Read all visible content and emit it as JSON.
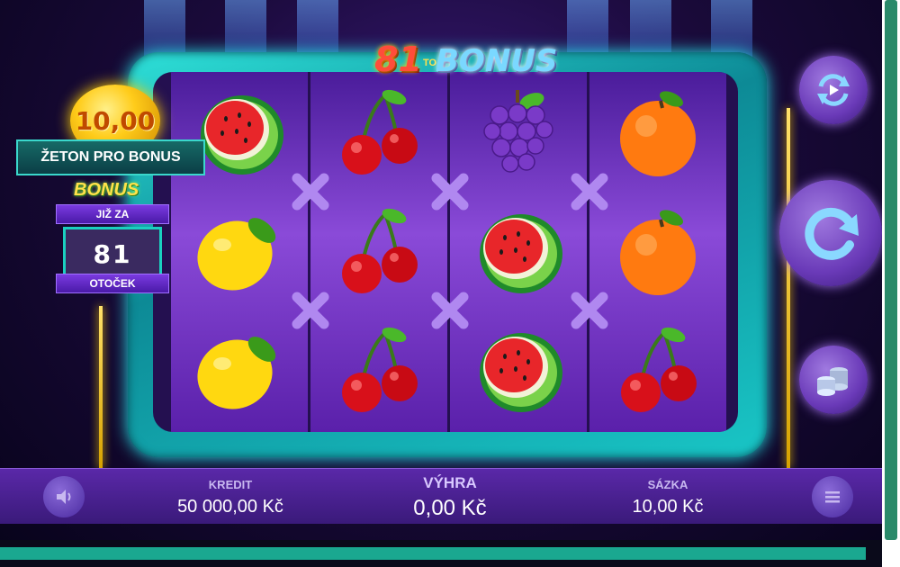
{
  "game": {
    "logo_number": "81",
    "logo_to": "TO",
    "logo_word": "BONUS"
  },
  "bonus_widget": {
    "coin_value": "10,00",
    "token_label": "ŽETON PRO BONUS",
    "bonus_title": "BONUS",
    "already_in": "JIŽ ZA",
    "spins_left": "81",
    "spins_label": "OTOČEK"
  },
  "reels": [
    [
      "watermelon",
      "lemon",
      "lemon"
    ],
    [
      "cherries",
      "cherries",
      "cherries"
    ],
    [
      "grapes",
      "watermelon",
      "watermelon"
    ],
    [
      "orange",
      "orange",
      "cherries"
    ]
  ],
  "bottom_bar": {
    "credit_label": "KREDIT",
    "credit_value": "50 000,00 Kč",
    "win_label": "VÝHRA",
    "win_value": "0,00 Kč",
    "bet_label": "SÁZKA",
    "bet_value": "10,00 Kč"
  },
  "controls": {
    "autoplay_icon": "autoplay-icon",
    "spin_icon": "spin-icon",
    "bet_icon": "coins-icon",
    "sound_icon": "speaker-icon",
    "menu_icon": "hamburger-menu-icon"
  },
  "colors": {
    "frame": "#1ad0c0",
    "reel_bg": "#8a4ad8",
    "bar_bg": "#5a28a8",
    "accent_gold": "#ffd200"
  }
}
